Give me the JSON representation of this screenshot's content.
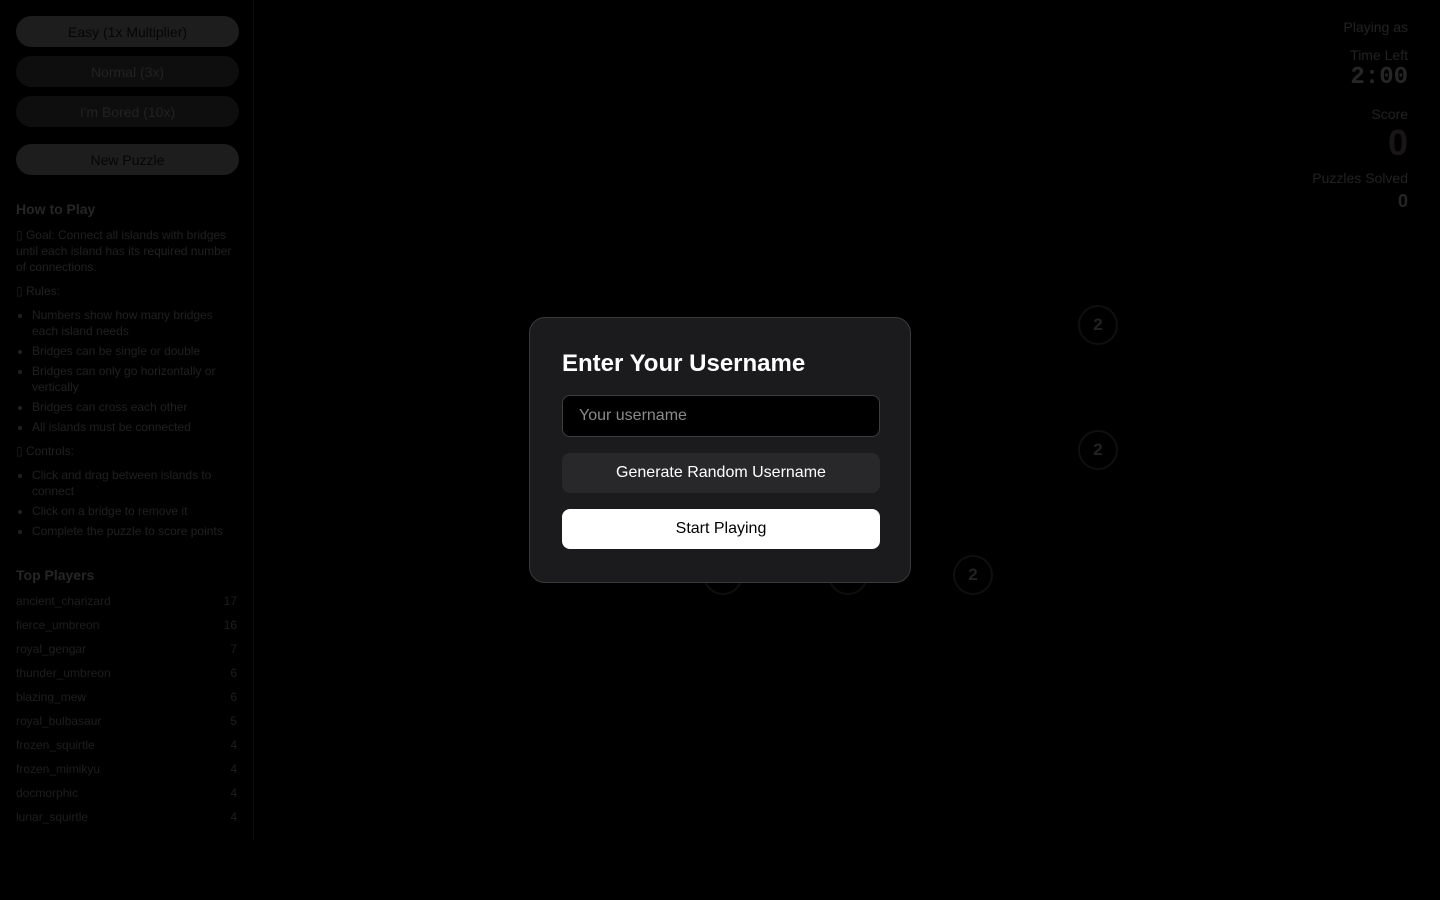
{
  "sidebar": {
    "difficulty": [
      {
        "label": "Easy (1x Multiplier)",
        "active": true
      },
      {
        "label": "Normal (3x)",
        "active": false
      },
      {
        "label": "I'm Bored (10x)",
        "active": false
      }
    ],
    "new_puzzle_label": "New Puzzle",
    "how_to_play": {
      "title": "How to Play",
      "goal": "▯ Goal: Connect all islands with bridges until each island has its required number of connections.",
      "rules_title": "▯ Rules:",
      "rules": [
        "Numbers show how many bridges each island needs",
        "Bridges can be single or double",
        "Bridges can only go horizontally or vertically",
        "Bridges can cross each other",
        "All islands must be connected"
      ],
      "controls_title": "▯ Controls:",
      "controls": [
        "Click and drag between islands to connect",
        "Click on a bridge to remove it",
        "Complete the puzzle to score points"
      ]
    },
    "leaderboard": {
      "title": "Top Players",
      "rows": [
        {
          "name": "ancient_charizard",
          "score": "17"
        },
        {
          "name": "fierce_umbreon",
          "score": "16"
        },
        {
          "name": "royal_gengar",
          "score": "7"
        },
        {
          "name": "thunder_umbreon",
          "score": "6"
        },
        {
          "name": "blazing_mew",
          "score": "6"
        },
        {
          "name": "royal_bulbasaur",
          "score": "5"
        },
        {
          "name": "frozen_squirtle",
          "score": "4"
        },
        {
          "name": "frozen_mimikyu",
          "score": "4"
        },
        {
          "name": "docmorphic",
          "score": "4"
        },
        {
          "name": "lunar_squirtle",
          "score": "4"
        }
      ]
    }
  },
  "stats": {
    "playing_as_label": "Playing as",
    "time_left_label": "Time Left",
    "time_left": "2:00",
    "score_label": "Score",
    "score": "0",
    "puzzles_solved_label": "Puzzles Solved",
    "puzzles_solved": "0"
  },
  "board": {
    "islands": [
      {
        "row": 0,
        "col": 4,
        "value": "2"
      },
      {
        "row": 1,
        "col": 4,
        "value": "2"
      },
      {
        "row": 2,
        "col": 3,
        "value": "2"
      },
      {
        "row": 2,
        "col": 1,
        "value": ""
      },
      {
        "row": 2,
        "col": 2,
        "value": ""
      }
    ]
  },
  "modal": {
    "title": "Enter Your Username",
    "username_value": "",
    "username_placeholder": "Your username",
    "generate_label": "Generate Random Username",
    "start_label": "Start Playing"
  }
}
